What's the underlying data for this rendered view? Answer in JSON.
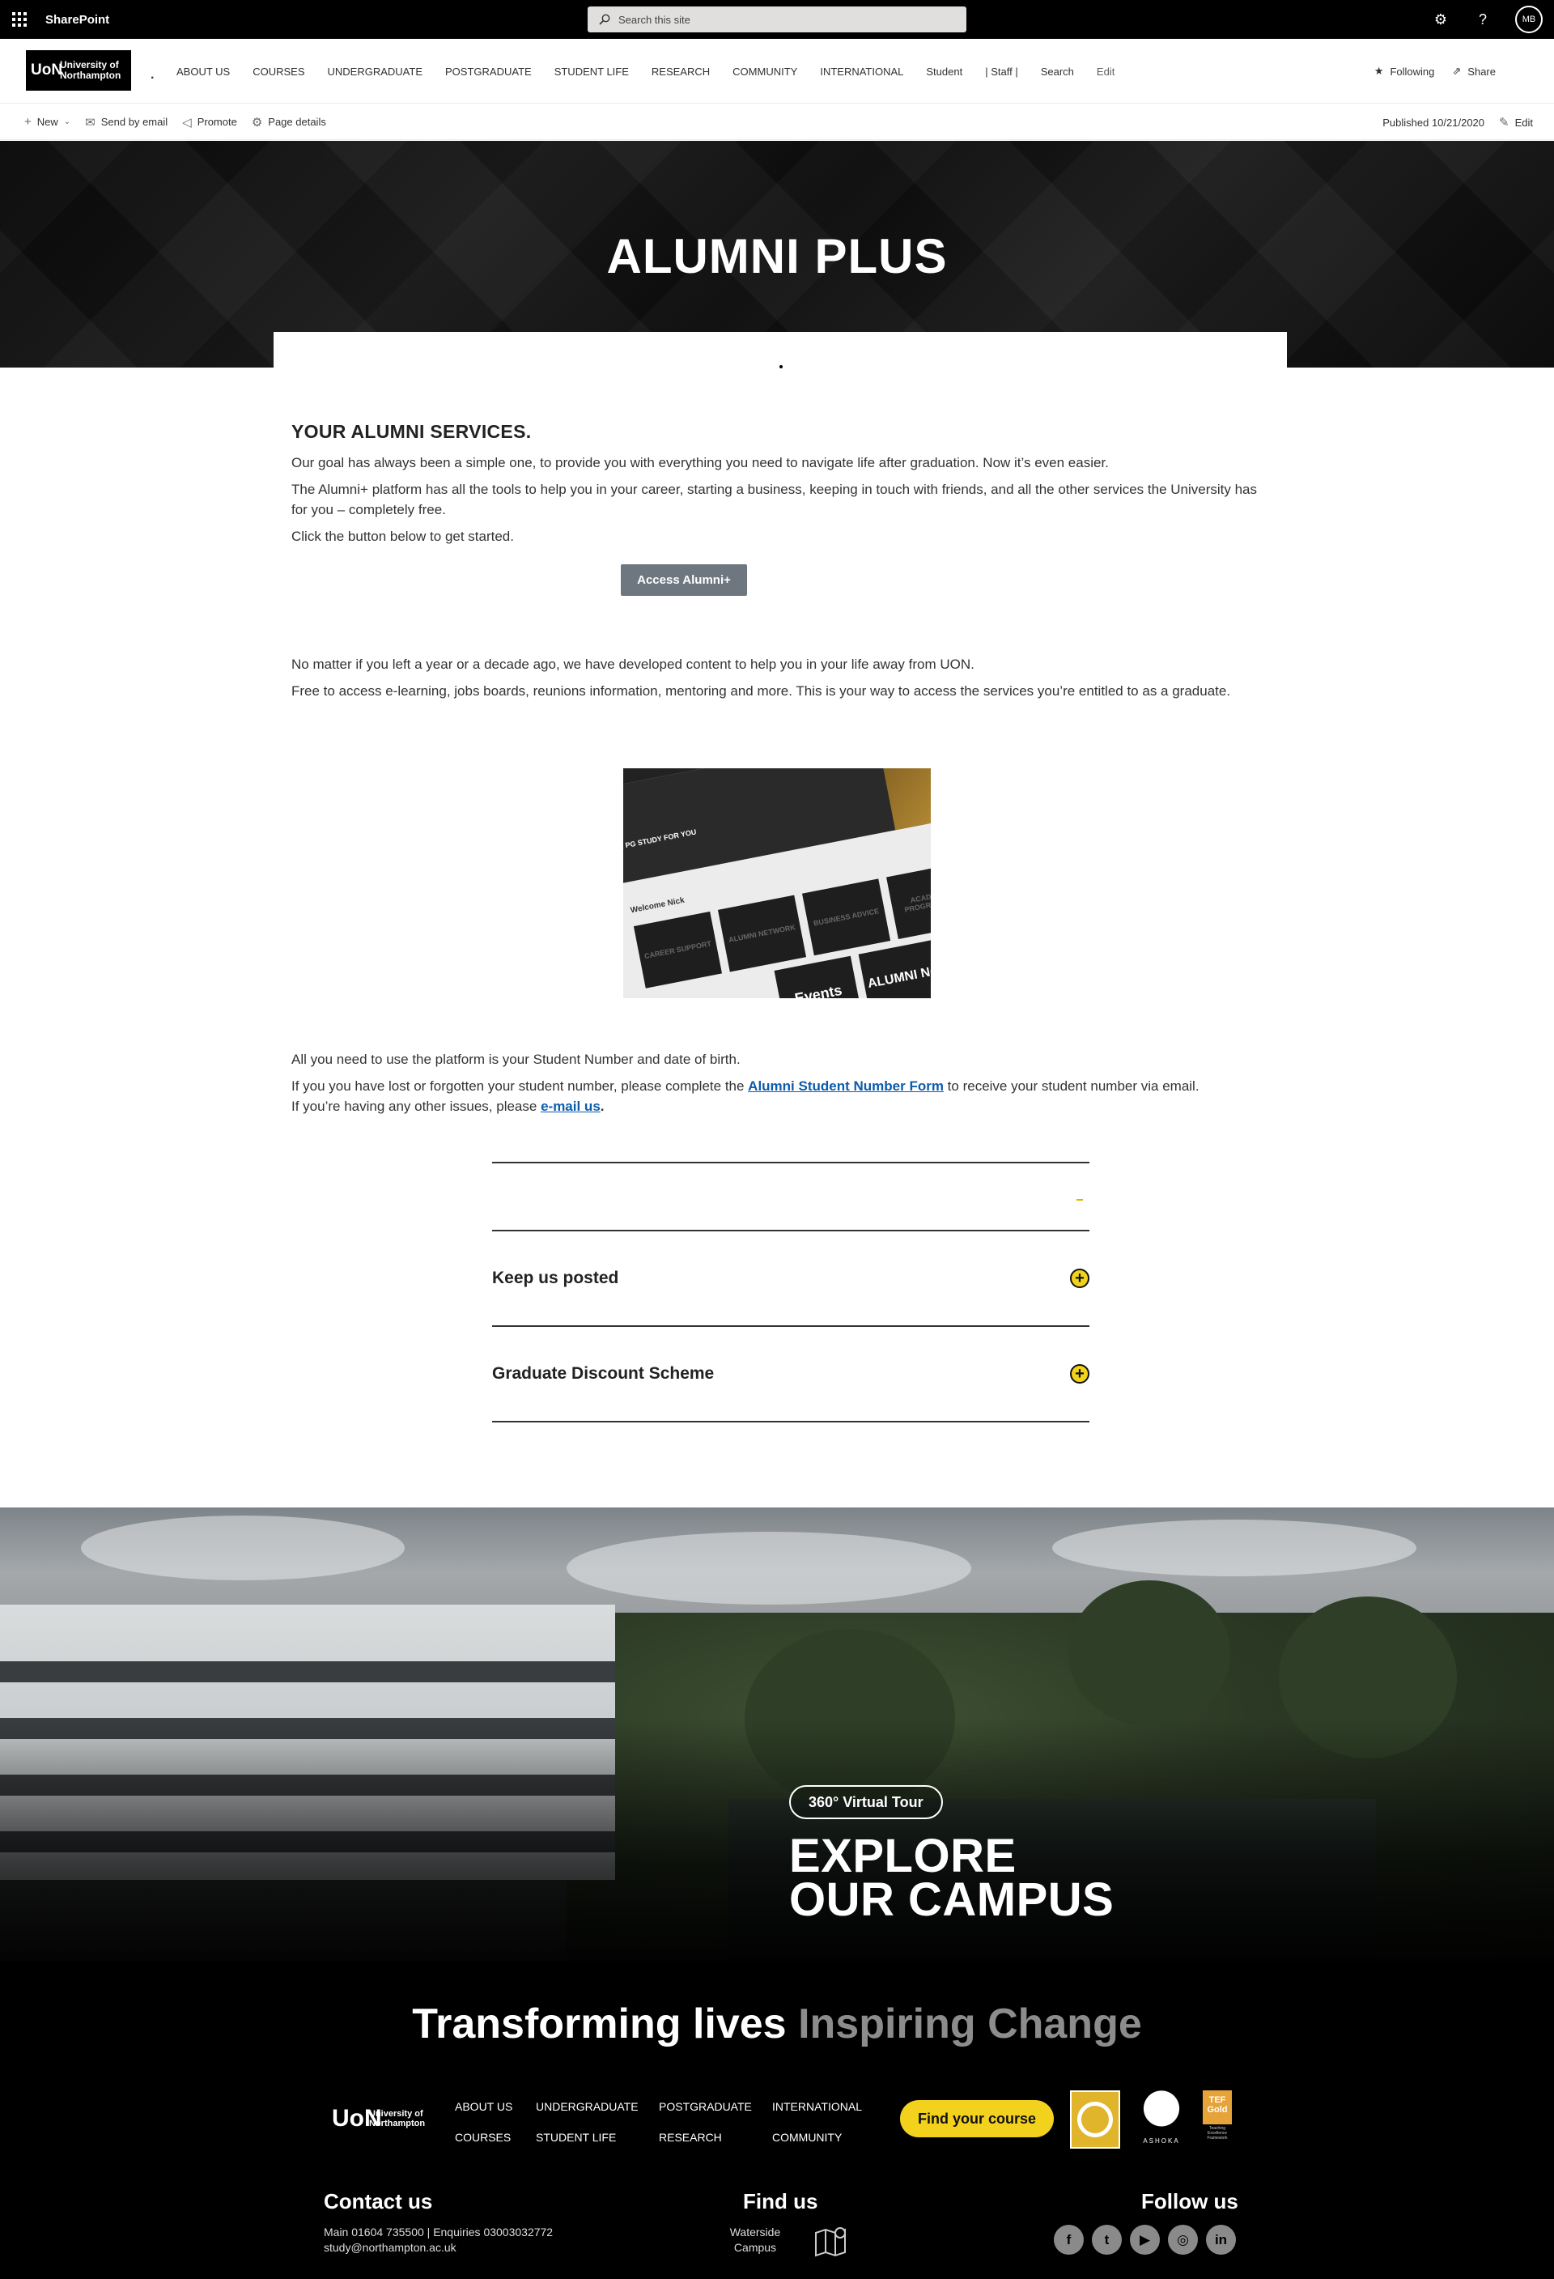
{
  "suite": {
    "brand": "SharePoint",
    "search_placeholder": "Search this site",
    "avatar_initials": "MB"
  },
  "site": {
    "logo_mark": "UoN",
    "logo_text_1": "University of",
    "logo_text_2": "Northampton",
    "site_title": ".",
    "nav": [
      "ABOUT US",
      "COURSES",
      "UNDERGRADUATE",
      "POSTGRADUATE",
      "STUDENT LIFE",
      "RESEARCH",
      "COMMUNITY",
      "INTERNATIONAL",
      "Student",
      "| Staff |",
      "Search",
      "Edit"
    ],
    "following": "Following",
    "share": "Share"
  },
  "commandbar": {
    "new": "New",
    "send_by_email": "Send by email",
    "promote": "Promote",
    "page_details": "Page details",
    "published": "Published 10/21/2020",
    "edit": "Edit"
  },
  "hero": {
    "title": "ALUMNI PLUS"
  },
  "intro": {
    "heading": "YOUR ALUMNI SERVICES.",
    "p1": "Our goal has always been a simple one, to provide you with everything you need to navigate life after graduation. Now it’s even easier.",
    "p2": "The Alumni+ platform has all the tools to help you in your career, starting a business, keeping in touch with friends, and all the other services the University has for you – completely free.",
    "p3": "Click the button below to get started.",
    "button": "Access Alumni+"
  },
  "second": {
    "p1": "No matter if you left a year or a decade ago, we have developed content to help you in your life away from UON.",
    "p2": "Free to access e-learning, jobs boards, reunions information, mentoring and more. This is your way to access the services you’re entitled to as a graduate."
  },
  "screenshot": {
    "bar_text": "R PG STUDY FOR YOU",
    "welcome": "Welcome Nick",
    "tiles": [
      "CAREER SUPPORT",
      "ALUMNI NETWORK",
      "BUSINESS ADVICE",
      "ACADEMIC PROGRESSION",
      "Events",
      "ALUMNI Ne"
    ]
  },
  "third": {
    "p1": "All you need to use the platform is your Student Number and date of birth.",
    "p2_before": "If you you have lost or forgotten your student number, please complete the ",
    "p2_link": "Alumni Student Number Form",
    "p2_after": " to receive your student number via email.",
    "p3_before": "If you’re having any other issues, please ",
    "p3_link": "e-mail us",
    "p3_after": "."
  },
  "accordion": {
    "items": [
      "Keep us posted",
      "Graduate Discount Scheme"
    ],
    "icon": "+"
  },
  "campus": {
    "tour": "360° Virtual Tour",
    "line1": "EXPLORE",
    "line2": "OUR CAMPUS"
  },
  "footer": {
    "tagline_1": "Transforming lives",
    "tagline_2": "Inspiring Change",
    "logo_mark": "UoN",
    "logo_text_1": "University of",
    "logo_text_2": "Northampton",
    "nav": [
      "ABOUT US",
      "UNDERGRADUATE",
      "POSTGRADUATE",
      "INTERNATIONAL",
      "COURSES",
      "STUDENT LIFE",
      "RESEARCH",
      "COMMUNITY"
    ],
    "find_course": "Find your course",
    "badge_ashoka": "ASHOKA",
    "badge_tef": "TEF Gold",
    "badge_tef_sub": "Teaching Excellence Framework",
    "contact_heading": "Contact us",
    "contact_line1": "Main 01604 735500 | Enquiries 03003032772",
    "contact_line2": "study@northampton.ac.uk",
    "find_heading": "Find us",
    "find_line1": "Waterside",
    "find_line2": "Campus",
    "follow_heading": "Follow us",
    "socials": [
      "f",
      "t",
      "▶",
      "◎",
      "in"
    ]
  },
  "colors": {
    "accent_yellow": "#f2d21d",
    "button_grey": "#6e7780",
    "link_blue": "#0b5cad"
  }
}
